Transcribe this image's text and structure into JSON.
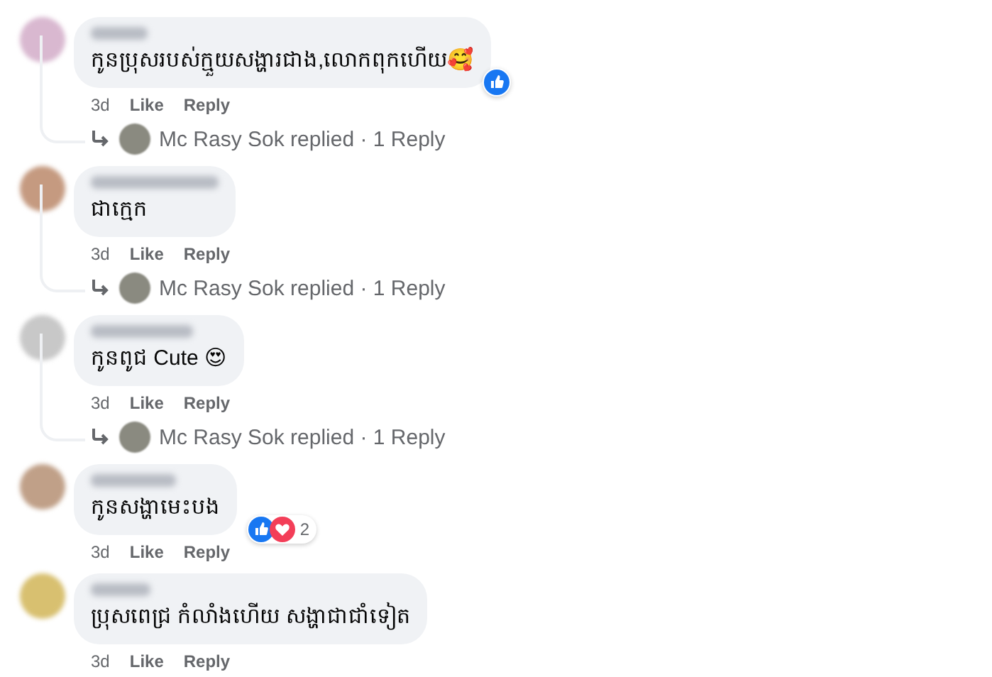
{
  "comments": [
    {
      "text": "កូនប្រុសរបស់ក្មួយសង្ហារជាង,លោកពុកហើយ🥰",
      "reactions": [
        {
          "kind": "like"
        }
      ],
      "time": "3d",
      "like": "Like",
      "reply": "Reply",
      "replied": {
        "text": "Mc Rasy Sok replied · 1 Reply"
      }
    },
    {
      "text": "ជាក្មេក",
      "time": "3d",
      "like": "Like",
      "reply": "Reply",
      "replied": {
        "text": "Mc Rasy Sok replied · 1 Reply"
      }
    },
    {
      "text": "កូនពូជ Cute 😍",
      "time": "3d",
      "like": "Like",
      "reply": "Reply",
      "replied": {
        "text": "Mc Rasy Sok replied · 1 Reply"
      }
    },
    {
      "text": "កូនសង្ហាមេះបង",
      "reactions": [
        {
          "kind": "like"
        },
        {
          "kind": "love"
        }
      ],
      "reaction_count": "2",
      "time": "3d",
      "like": "Like",
      "reply": "Reply"
    },
    {
      "text": "ប្រុសពេជ្រ កំលាំងហើយ សង្ហាជាជាំទៀត",
      "time": "3d",
      "like": "Like",
      "reply": "Reply"
    }
  ]
}
